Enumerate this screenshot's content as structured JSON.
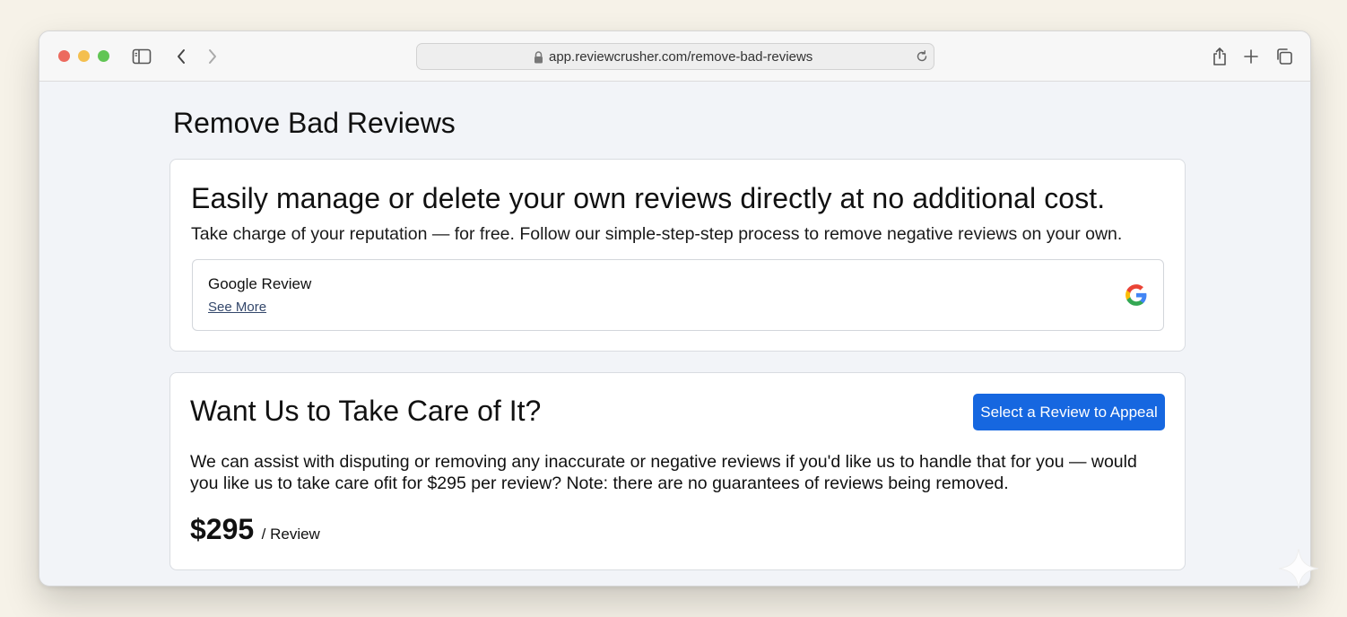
{
  "browser": {
    "url": "app.reviewcrusher.com/remove-bad-reviews",
    "icons": [
      "sidebar-icon",
      "back-icon",
      "forward-icon",
      "lock-icon",
      "reload-icon",
      "share-icon",
      "new-tab-icon",
      "tabs-overview-icon"
    ]
  },
  "page": {
    "title": "Remove Bad Reviews"
  },
  "self_service": {
    "heading": "Easily manage or delete your own reviews directly at no additional cost.",
    "subheading": "Take charge of your reputation — for free. Follow our simple-step-step process to remove negative reviews on your own.",
    "review": {
      "title": "Google Review",
      "link": "See More",
      "icon": "google-icon"
    }
  },
  "managed_service": {
    "heading": "Want Us to Take Care of It?",
    "button_label": "Select a Review to Appeal",
    "body": "We can assist with disputing or removing any inaccurate or negative reviews if you'd like us to handle that for you — would you like us to take care ofit for $295 per review? Note: there are no guarantees of reviews being removed.",
    "price": "$295",
    "price_unit": "/ Review"
  },
  "colors": {
    "accent": "#1667e0",
    "link": "#33476b",
    "page_background": "#f2f4f8"
  }
}
